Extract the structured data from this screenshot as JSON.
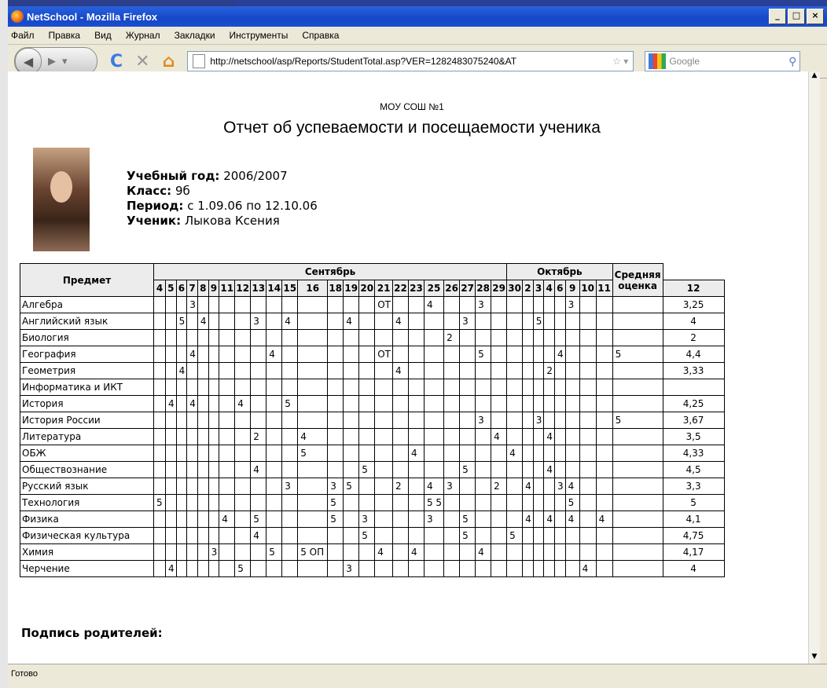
{
  "window": {
    "title": "NetSchool - Mozilla Firefox"
  },
  "menu": [
    "Файл",
    "Правка",
    "Вид",
    "Журнал",
    "Закладки",
    "Инструменты",
    "Справка"
  ],
  "nav": {
    "url": "http://netschool/asp/Reports/StudentTotal.asp?VER=1282483075240&AT",
    "search_placeholder": "Google"
  },
  "status": "Готово",
  "report": {
    "school": "МОУ СОШ №1",
    "title": "Отчет об успеваемости и посещаемости ученика",
    "year_label": "Учебный год:",
    "year": "2006/2007",
    "class_label": "Класс:",
    "class": "9б",
    "period_label": "Период:",
    "period": "с 1.09.06 по 12.10.06",
    "student_label": "Ученик:",
    "student": "Лыкова Ксения",
    "signature": "Подпись родителей:"
  },
  "table": {
    "subject_header": "Предмет",
    "avg_header": "Средняя оценка",
    "months": [
      {
        "name": "Сентябрь",
        "span": 23
      },
      {
        "name": "Октябрь",
        "span": 8
      }
    ],
    "days": [
      "4",
      "5",
      "6",
      "7",
      "8",
      "9",
      "11",
      "12",
      "13",
      "14",
      "15",
      "16",
      "18",
      "19",
      "20",
      "21",
      "22",
      "23",
      "25",
      "26",
      "27",
      "28",
      "29",
      "30",
      "2",
      "3",
      "4",
      "6",
      "9",
      "10",
      "11",
      "12"
    ],
    "rows": [
      {
        "subject": "Алгебра",
        "cells": {
          "3": "3",
          "15": "ОТ",
          "18": "4",
          "21": "3",
          "28": "3"
        },
        "avg": "3,25"
      },
      {
        "subject": "Английский язык",
        "cells": {
          "2": "5",
          "4": "4",
          "8": "3",
          "10": "4",
          "13": "4",
          "16": "4",
          "20": "3",
          "25": "5"
        },
        "avg": "4"
      },
      {
        "subject": "Биология",
        "cells": {
          "19": "2"
        },
        "avg": "2"
      },
      {
        "subject": "География",
        "cells": {
          "3": "4",
          "9": "4",
          "15": "ОТ",
          "21": "5",
          "27": "4",
          "31": "5"
        },
        "avg": "4,4"
      },
      {
        "subject": "Геометрия",
        "cells": {
          "2": "4",
          "16": "4",
          "26": "2"
        },
        "avg": "3,33"
      },
      {
        "subject": "Информатика и ИКТ",
        "cells": {},
        "avg": ""
      },
      {
        "subject": "История",
        "cells": {
          "1": "4",
          "3": "4",
          "7": "4",
          "10": "5"
        },
        "avg": "4,25"
      },
      {
        "subject": "История России",
        "cells": {
          "21": "3",
          "25": "3",
          "31": "5"
        },
        "avg": "3,67"
      },
      {
        "subject": "Литература",
        "cells": {
          "8": "2",
          "11": "4",
          "22": "4",
          "26": "4"
        },
        "avg": "3,5"
      },
      {
        "subject": "ОБЖ",
        "cells": {
          "11": "5",
          "17": "4",
          "23": "4"
        },
        "avg": "4,33"
      },
      {
        "subject": "Обществознание",
        "cells": {
          "8": "4",
          "14": "5",
          "20": "5",
          "26": "4"
        },
        "avg": "4,5"
      },
      {
        "subject": "Русский язык",
        "cells": {
          "10": "3",
          "12": "3",
          "13": "5",
          "16": "2",
          "18": "4",
          "19": "3",
          "22": "2",
          "24": "4",
          "27": "3",
          "28": "4"
        },
        "avg": "3,3"
      },
      {
        "subject": "Технология",
        "cells": {
          "0": "5",
          "12": "5",
          "18": "5 5",
          "28": "5"
        },
        "avg": "5"
      },
      {
        "subject": "Физика",
        "cells": {
          "6": "4",
          "8": "5",
          "12": "5",
          "14": "3",
          "18": "3",
          "20": "5",
          "24": "4",
          "26": "4",
          "28": "4",
          "30": "4"
        },
        "avg": "4,1"
      },
      {
        "subject": "Физическая культура",
        "cells": {
          "8": "4",
          "14": "5",
          "20": "5",
          "23": "5"
        },
        "avg": "4,75"
      },
      {
        "subject": "Химия",
        "cells": {
          "5": "3",
          "9": "5",
          "11": "5 ОП",
          "15": "4",
          "17": "4",
          "21": "4"
        },
        "avg": "4,17"
      },
      {
        "subject": "Черчение",
        "cells": {
          "1": "4",
          "7": "5",
          "13": "3",
          "29": "4"
        },
        "avg": "4"
      }
    ]
  }
}
